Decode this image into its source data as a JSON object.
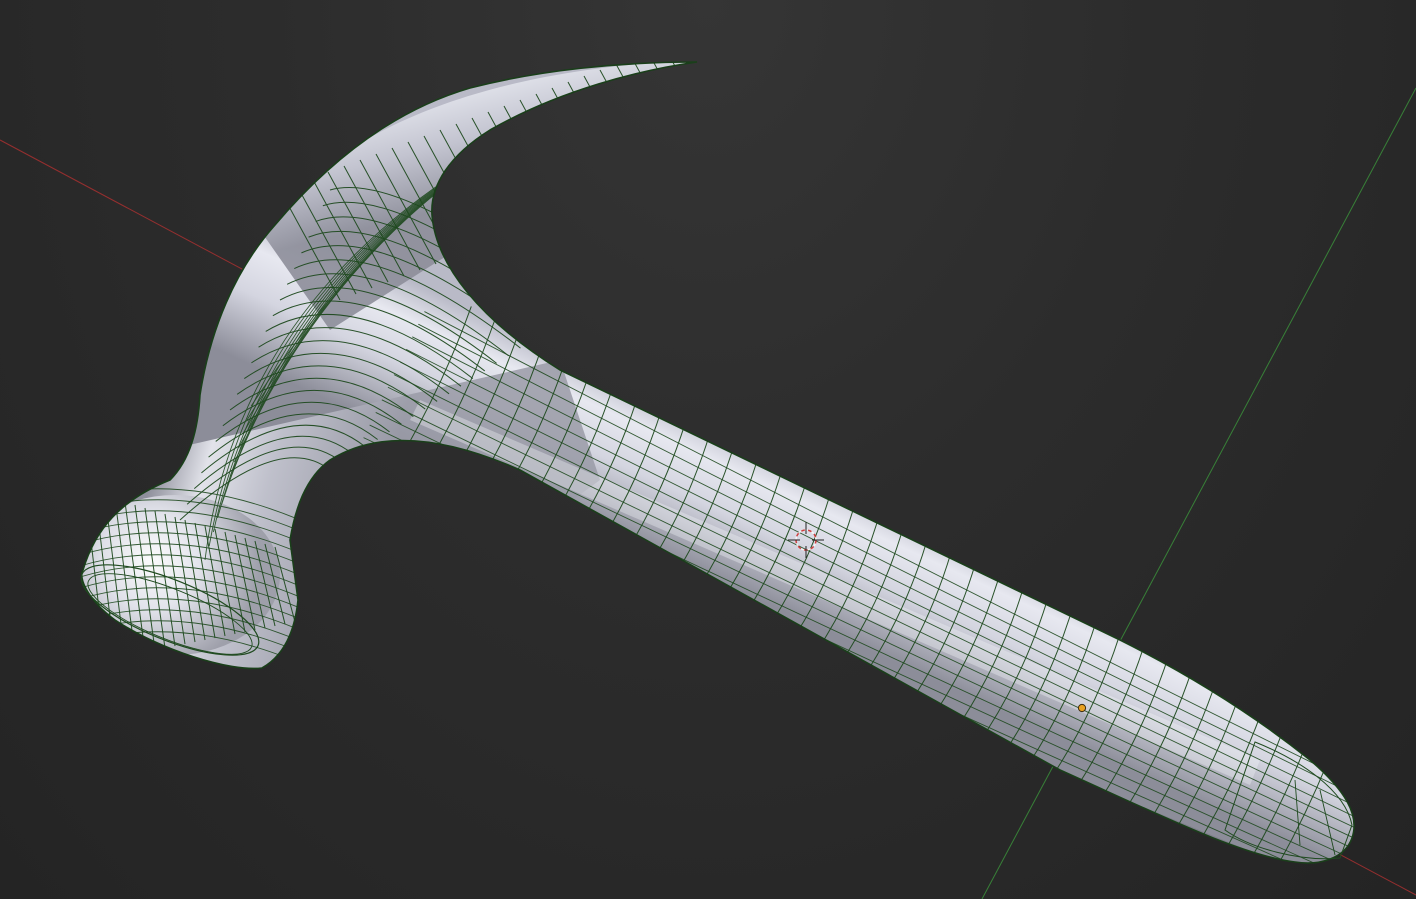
{
  "viewport": {
    "mode": "3d-viewport",
    "object": "hammer-mesh",
    "display": "wireframe-on-shaded",
    "colors": {
      "background": "#2b2b2b",
      "x_axis": "#b03030",
      "y_axis": "#3c8c3c",
      "wire": "#1f4a1f",
      "mesh_light": "#f2f3f8",
      "mesh_mid": "#c9cad6",
      "mesh_dark": "#7e7f8c",
      "cursor_ring": "#d04040",
      "origin_dot": "#e8a020"
    },
    "icons": {
      "cursor": "3d-cursor-icon",
      "origin": "object-origin-icon"
    }
  }
}
